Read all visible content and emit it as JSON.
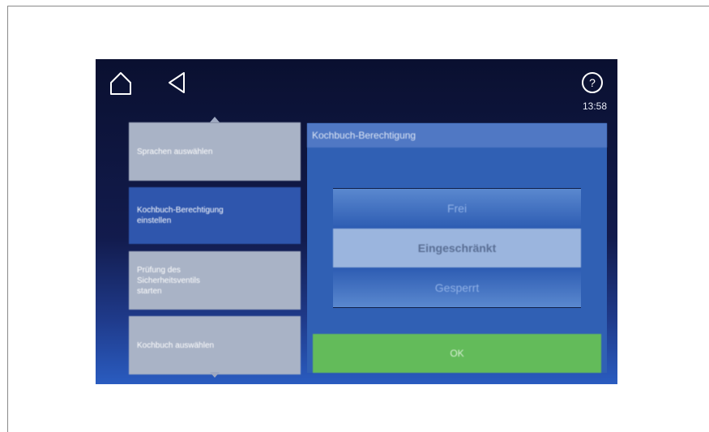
{
  "header": {
    "time": "13:58"
  },
  "menu": {
    "items": [
      {
        "label": "Sprachen auswählen"
      },
      {
        "label": "Kochbuch-Berechtigung\neinstellen"
      },
      {
        "label": "Prüfung des\nSicherheitsventils\nstarten"
      },
      {
        "label": "Kochbuch auswählen"
      }
    ]
  },
  "panel": {
    "title": "Kochbuch-Berechtigung",
    "options": [
      "Frei",
      "Eingeschränkt",
      "Gesperrt"
    ],
    "ok_label": "OK"
  },
  "icons": {
    "home": "home-icon",
    "back": "back-triangle-icon",
    "help": "help-circle-icon",
    "scroll_up": "chevron-up-icon",
    "scroll_down": "chevron-down-icon"
  },
  "colors": {
    "selected_menu": "#2f56ad",
    "menu_item": "#a9b3c6",
    "ok_button": "#63bb5a",
    "panel": "#3060b4"
  }
}
